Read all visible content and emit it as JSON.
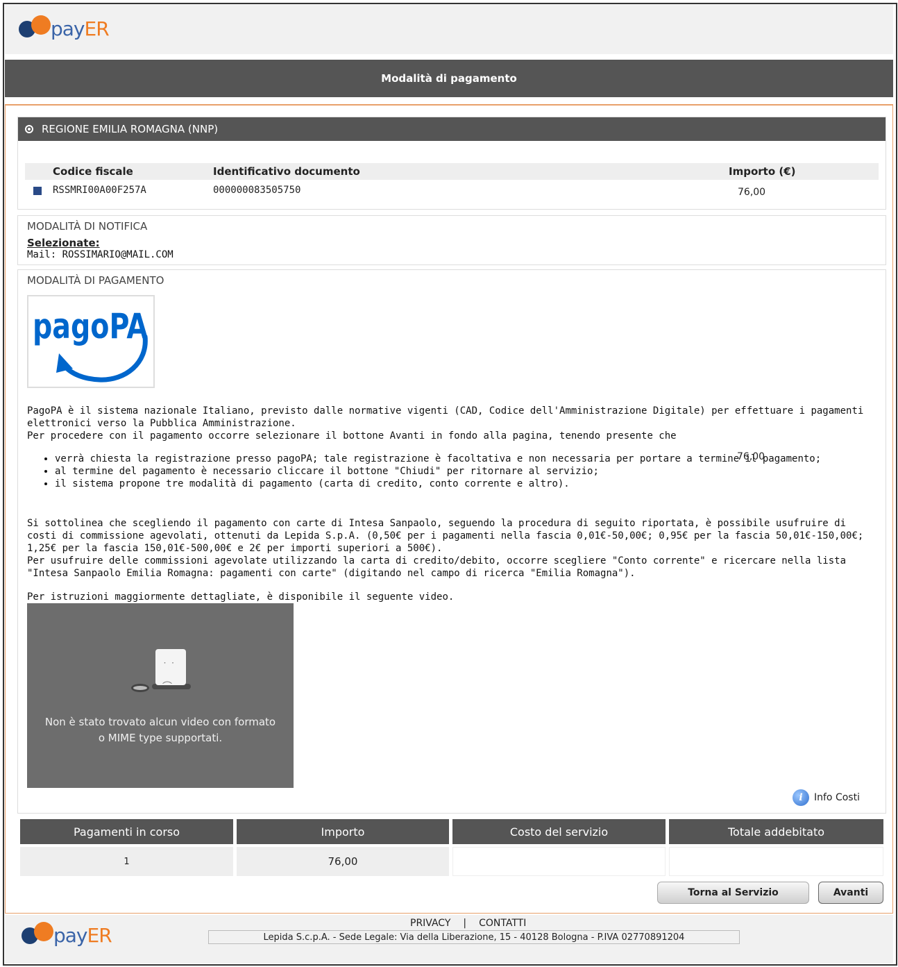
{
  "header": {
    "logo_pay": "pay",
    "logo_er": "ER"
  },
  "title_bar": {
    "title": "Modalità di pagamento"
  },
  "ente": {
    "name": "REGIONE EMILIA ROMAGNA (NNP)",
    "columns": [
      "Codice fiscale",
      "Identificativo documento",
      "Importo (€)"
    ],
    "row": {
      "codice_fiscale": "RSSMRI00A00F257A",
      "identificativo": "000000083505750",
      "importo": "76,00"
    }
  },
  "notifica": {
    "title": "MODALITÀ DI NOTIFICA",
    "selected_label": "Selezionate:",
    "mail": "Mail: ROSSIMARIO@MAIL.COM"
  },
  "pagamento": {
    "title": "MODALITÀ DI PAGAMENTO",
    "logo_text": "pagoPA",
    "intro_1": "PagoPA è il sistema nazionale Italiano, previsto dalle normative vigenti (CAD, Codice dell'Amministrazione Digitale) per effettuare i pagamenti elettronici verso la Pubblica Amministrazione.",
    "intro_2": "Per procedere con il pagamento occorre selezionare il bottone Avanti in fondo alla pagina, tenendo presente che",
    "bullets": [
      "verrà chiesta la registrazione presso pagoPA; tale registrazione è facoltativa e non necessaria per portare a termine il pagamento;",
      "al termine del pagamento è necessario cliccare il bottone \"Chiudi\" per ritornare al servizio;",
      "il sistema propone tre modalità di pagamento (carta di credito, conto corrente e altro)."
    ],
    "overlap_amount": "76,00",
    "note_1": "Si sottolinea che scegliendo il pagamento con carte di Intesa Sanpaolo, seguendo la procedura di seguito riportata, è possibile usufruire di costi di commissione agevolati, ottenuti da Lepida S.p.A. (0,50€ per i pagamenti nella fascia 0,01€-50,00€; 0,95€ per la fascia 50,01€-150,00€; 1,25€ per la fascia 150,01€-500,00€ e 2€ per importi superiori a 500€).",
    "note_2": "Per usufruire delle commissioni agevolate utilizzando la carta di credito/debito, occorre scegliere \"Conto corrente\" e ricercare nella lista \"Intesa Sanpaolo Emilia Romagna: pagamenti con carte\" (digitando nel campo di ricerca \"Emilia Romagna\").",
    "video_intro": "Per istruzioni maggiormente dettagliate, è disponibile il seguente video.",
    "video_error_1": "Non è stato trovato alcun video con formato",
    "video_error_2": "o MIME type supportati.",
    "info_costi": "Info Costi"
  },
  "summary": {
    "headers": [
      "Pagamenti in corso",
      "Importo",
      "Costo del servizio",
      "Totale addebitato"
    ],
    "values": [
      "1",
      "76,00",
      "",
      ""
    ]
  },
  "buttons": {
    "back": "Torna al Servizio",
    "next": "Avanti"
  },
  "footer": {
    "privacy": "PRIVACY",
    "separator": "|",
    "contatti": "CONTATTI",
    "legal": "Lepida S.c.p.A. - Sede Legale: Via della Liberazione, 15 - 40128 Bologna - P.IVA 02770891204"
  },
  "colors": {
    "accent_orange": "#ef7c22",
    "brand_blue": "#1d3f72",
    "bar_gray": "#555555",
    "pagopa_blue": "#0066cc"
  }
}
